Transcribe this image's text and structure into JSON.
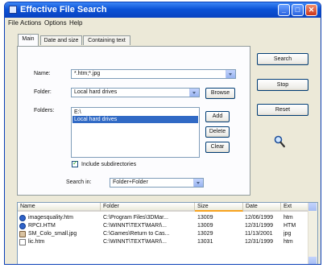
{
  "window": {
    "title": "Effective File Search"
  },
  "menu": [
    "File",
    "Actions",
    "Options",
    "Help"
  ],
  "tabs": [
    "Main",
    "Date and size",
    "Containing text"
  ],
  "form": {
    "name_label": "Name:",
    "name_value": "*.htm;*.jpg",
    "folder_label": "Folder:",
    "folder_value": "Local hard drives",
    "browse_label": "Browse",
    "folders_label": "Folders:",
    "folders": [
      "E:\\",
      "Local hard drives"
    ],
    "add_label": "Add",
    "delete_label": "Delete",
    "clear_label": "Clear",
    "include_sub_label": "Include subdirectories",
    "search_in_label": "Search in:",
    "search_in_value": "Folder+Folder"
  },
  "actions": {
    "search": "Search",
    "stop": "Stop",
    "reset": "Reset"
  },
  "results": {
    "columns": [
      "Name",
      "Folder",
      "Size",
      "Date",
      "Ext"
    ],
    "rows": [
      {
        "name": "imagesquality.htm",
        "folder": "C:\\Program Files\\3DMar...",
        "size": "13009",
        "date": "12/06/1999",
        "ext": "htm",
        "icon": "ie"
      },
      {
        "name": "RPCI.HTM",
        "folder": "C:\\WINNT\\TEXT\\MARI\\...",
        "size": "13009",
        "date": "12/31/1999",
        "ext": "HTM",
        "icon": "ie"
      },
      {
        "name": "SM_Colo_small.jpg",
        "folder": "C:\\Games\\Return to Cas...",
        "size": "13029",
        "date": "11/13/2001",
        "ext": "jpg",
        "icon": "img"
      },
      {
        "name": "lic.htm",
        "folder": "C:\\WINNT\\TEXT\\MARI\\...",
        "size": "13031",
        "date": "12/31/1999",
        "ext": "htm",
        "icon": "txt"
      }
    ]
  }
}
